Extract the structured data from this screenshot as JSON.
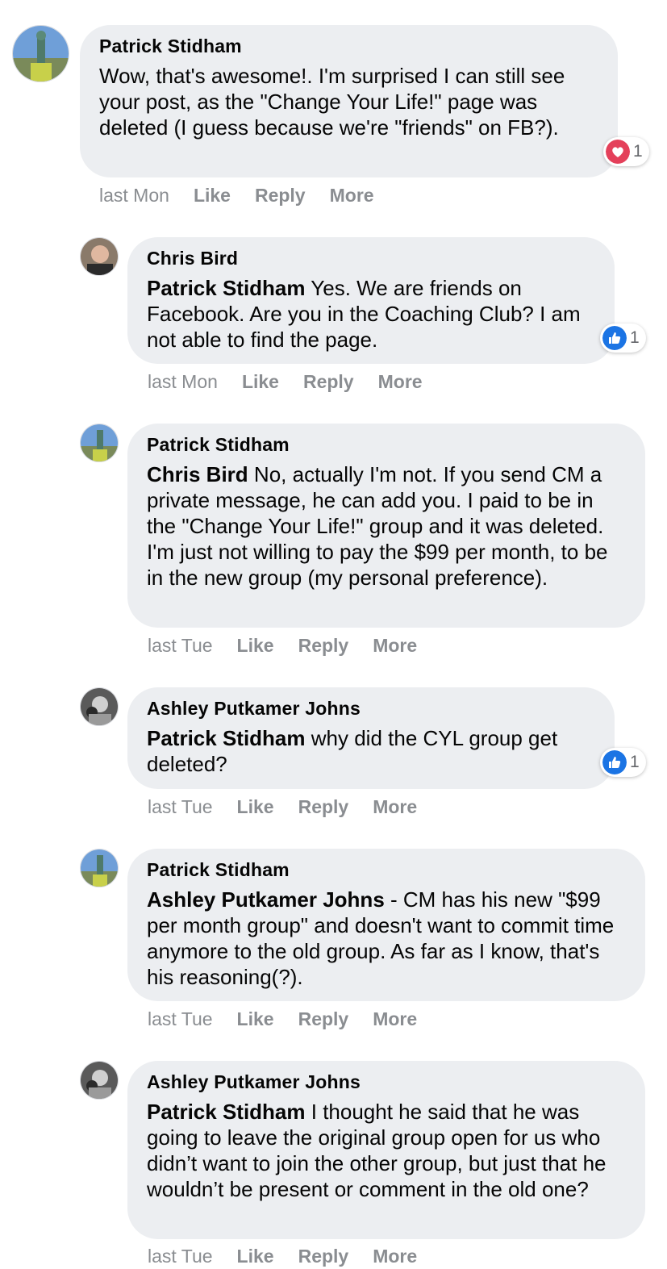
{
  "comments": [
    {
      "author": "Patrick Stidham",
      "mention": "",
      "text": "Wow, that's awesome!. I'm surprised I can still see your post, as the \"Change Your Life!\" page was deleted (I guess because we're \"friends\" on FB?).",
      "time": "last Mon",
      "like": "Like",
      "reply": "Reply",
      "more": "More",
      "reaction": {
        "icon": "heart-reaction-icon",
        "count": "1",
        "color": "#e4405a"
      }
    },
    {
      "author": "Chris Bird",
      "mention": "Patrick Stidham",
      "text": "Yes. We are friends on Facebook. Are you in the Coaching Club? I am not able to find the page.",
      "time": "last Mon",
      "like": "Like",
      "reply": "Reply",
      "more": "More",
      "reaction": {
        "icon": "like-reaction-icon",
        "count": "1",
        "color": "#1b74e4"
      }
    },
    {
      "author": "Patrick Stidham",
      "mention": "Chris Bird",
      "text": "No, actually I'm not. If you send CM a private message, he can add you. I paid to be in the \"Change Your Life!\" group and it was deleted. I'm just not willing to pay the $99 per month, to be in the new group (my personal preference).",
      "time": "last Tue",
      "like": "Like",
      "reply": "Reply",
      "more": "More"
    },
    {
      "author": "Ashley Putkamer Johns",
      "mention": "Patrick Stidham",
      "text": "why did the CYL group get deleted?",
      "time": "last Tue",
      "like": "Like",
      "reply": "Reply",
      "more": "More",
      "reaction": {
        "icon": "like-reaction-icon",
        "count": "1",
        "color": "#1b74e4"
      }
    },
    {
      "author": "Patrick Stidham",
      "mention": "Ashley Putkamer Johns",
      "text": "- CM has his new \"$99 per month group\" and doesn't want to commit time anymore to the old group. As far as I know, that's his reasoning(?).",
      "time": "last Tue",
      "like": "Like",
      "reply": "Reply",
      "more": "More"
    },
    {
      "author": "Ashley Putkamer Johns",
      "mention": "Patrick Stidham",
      "text": "I thought he said that he was going to leave the original group open for us who didn’t want to join the other group, but just that he wouldn’t be present or comment in the old one?",
      "time": "last Tue",
      "like": "Like",
      "reply": "Reply",
      "more": "More"
    }
  ]
}
